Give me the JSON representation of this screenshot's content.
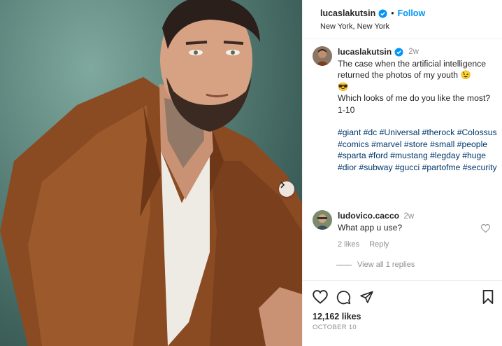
{
  "post": {
    "photo_alt": "photo of man in brown leather jacket",
    "username": "lucaslakutsin",
    "follow_label": "Follow",
    "dot": "•",
    "location": "New York, New York"
  },
  "caption": {
    "username": "lucaslakutsin",
    "time": "2w",
    "line1": "The case when the artificial intelligence returned the photos of my youth 😉",
    "line2": "😎",
    "line3": "Which looks of me do you like the most? 1-10",
    "hashtags": "#giant #dc #Universal #therock #Colossus #comics #marvel #store #small #people #sparta #ford #mustang #legday #huge #dior #subway #gucci #partofme #security"
  },
  "comment": {
    "username": "ludovico.cacco",
    "time": "2w",
    "text": "What app u use?",
    "likes": "2 likes",
    "reply_label": "Reply",
    "view_replies": "View all 1 replies"
  },
  "footer": {
    "likes": "12,162 likes",
    "date": "OCTOBER 10"
  },
  "colors": {
    "accent": "#0095f6",
    "hashtag": "#00376b",
    "muted": "#8e8e8e",
    "verified": "#0095f6"
  },
  "icons": [
    "chevron-right-icon",
    "verified-icon",
    "heart-icon",
    "comment-icon",
    "share-icon",
    "bookmark-icon"
  ]
}
